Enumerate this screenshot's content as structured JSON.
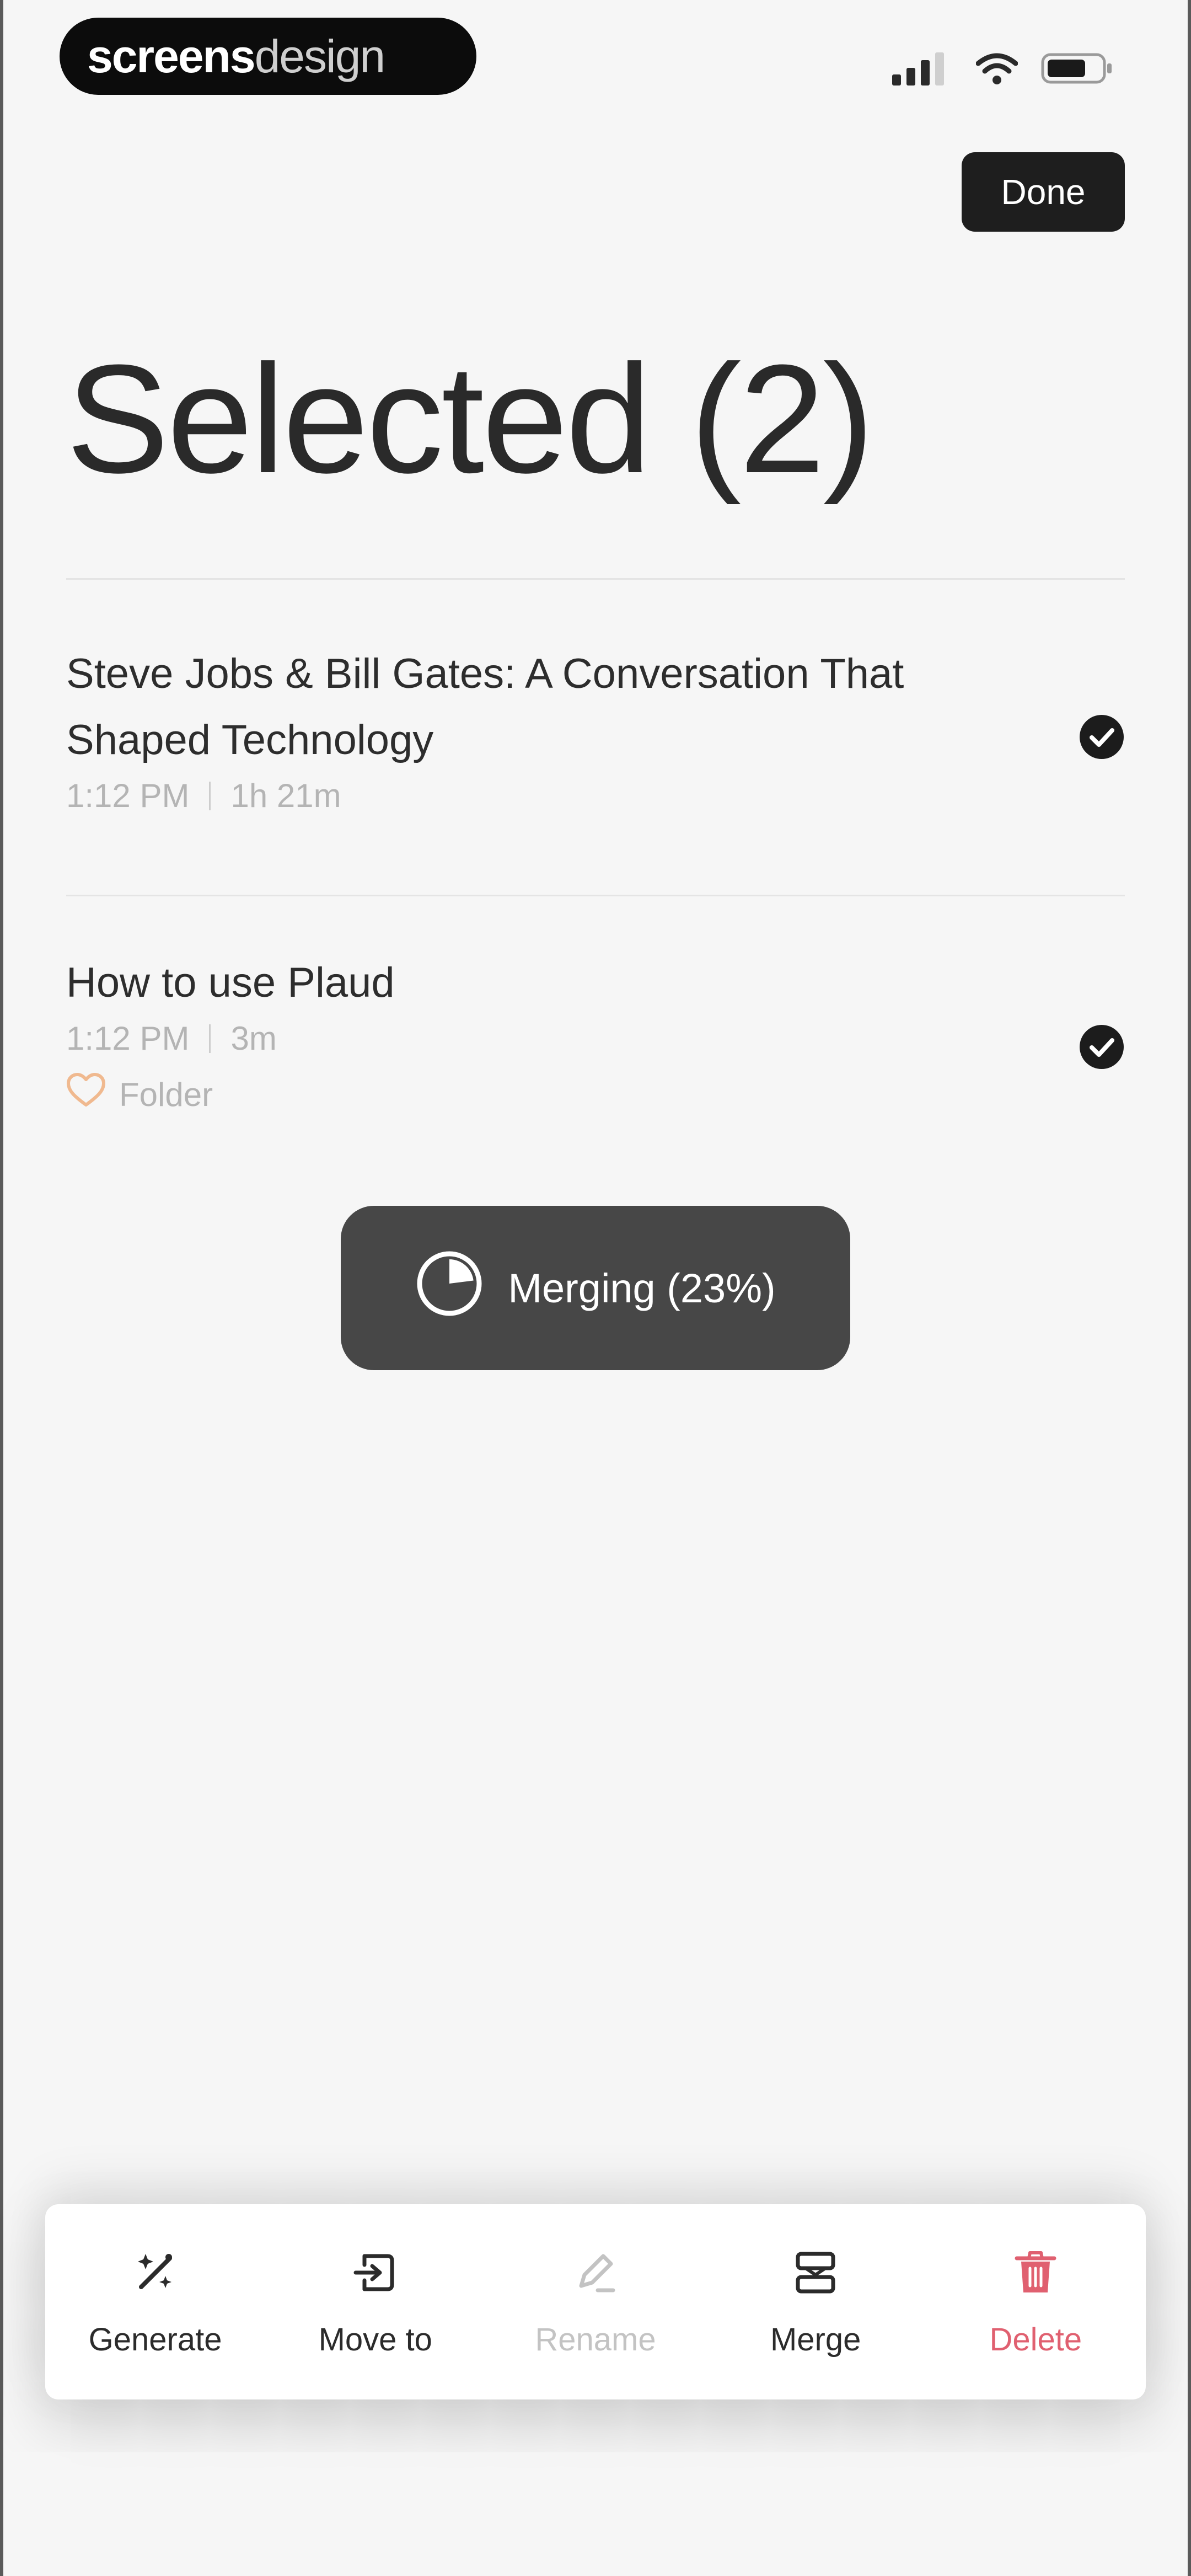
{
  "status_bar": {
    "brand_bold": "screens",
    "brand_light": "design",
    "signal_icon": "cellular-signal-icon",
    "wifi_icon": "wifi-icon",
    "battery_icon": "battery-icon"
  },
  "header": {
    "done_label": "Done",
    "title": "Selected (2)"
  },
  "items": [
    {
      "title": "Steve Jobs & Bill Gates: A Conversation That Shaped Technology",
      "time": "1:12 PM",
      "duration": "1h 21m",
      "selected": true
    },
    {
      "title": "How to use Plaud",
      "time": "1:12 PM",
      "duration": "3m",
      "folder": "Folder",
      "selected": true
    }
  ],
  "toast": {
    "text": "Merging (23%)",
    "progress": 0.23
  },
  "actions": [
    {
      "label": "Generate",
      "icon": "generate-icon",
      "state": "enabled"
    },
    {
      "label": "Move to",
      "icon": "move-to-icon",
      "state": "enabled"
    },
    {
      "label": "Rename",
      "icon": "rename-icon",
      "state": "disabled"
    },
    {
      "label": "Merge",
      "icon": "merge-icon",
      "state": "enabled"
    },
    {
      "label": "Delete",
      "icon": "trash-icon",
      "state": "danger"
    }
  ],
  "colors": {
    "background": "#f6f6f6",
    "toast": "#474747",
    "danger": "#e06070",
    "folder_heart": "#f0b98f"
  }
}
